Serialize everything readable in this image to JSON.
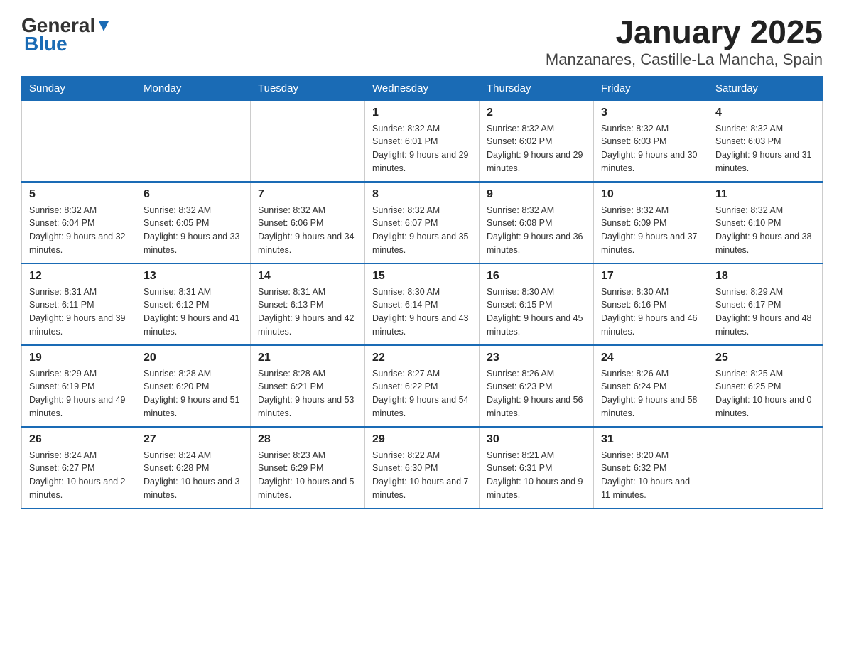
{
  "header": {
    "logo_general": "General",
    "logo_blue": "Blue",
    "title": "January 2025",
    "subtitle": "Manzanares, Castille-La Mancha, Spain"
  },
  "days_of_week": [
    "Sunday",
    "Monday",
    "Tuesday",
    "Wednesday",
    "Thursday",
    "Friday",
    "Saturday"
  ],
  "weeks": [
    [
      {
        "day": "",
        "info": ""
      },
      {
        "day": "",
        "info": ""
      },
      {
        "day": "",
        "info": ""
      },
      {
        "day": "1",
        "info": "Sunrise: 8:32 AM\nSunset: 6:01 PM\nDaylight: 9 hours and 29 minutes."
      },
      {
        "day": "2",
        "info": "Sunrise: 8:32 AM\nSunset: 6:02 PM\nDaylight: 9 hours and 29 minutes."
      },
      {
        "day": "3",
        "info": "Sunrise: 8:32 AM\nSunset: 6:03 PM\nDaylight: 9 hours and 30 minutes."
      },
      {
        "day": "4",
        "info": "Sunrise: 8:32 AM\nSunset: 6:03 PM\nDaylight: 9 hours and 31 minutes."
      }
    ],
    [
      {
        "day": "5",
        "info": "Sunrise: 8:32 AM\nSunset: 6:04 PM\nDaylight: 9 hours and 32 minutes."
      },
      {
        "day": "6",
        "info": "Sunrise: 8:32 AM\nSunset: 6:05 PM\nDaylight: 9 hours and 33 minutes."
      },
      {
        "day": "7",
        "info": "Sunrise: 8:32 AM\nSunset: 6:06 PM\nDaylight: 9 hours and 34 minutes."
      },
      {
        "day": "8",
        "info": "Sunrise: 8:32 AM\nSunset: 6:07 PM\nDaylight: 9 hours and 35 minutes."
      },
      {
        "day": "9",
        "info": "Sunrise: 8:32 AM\nSunset: 6:08 PM\nDaylight: 9 hours and 36 minutes."
      },
      {
        "day": "10",
        "info": "Sunrise: 8:32 AM\nSunset: 6:09 PM\nDaylight: 9 hours and 37 minutes."
      },
      {
        "day": "11",
        "info": "Sunrise: 8:32 AM\nSunset: 6:10 PM\nDaylight: 9 hours and 38 minutes."
      }
    ],
    [
      {
        "day": "12",
        "info": "Sunrise: 8:31 AM\nSunset: 6:11 PM\nDaylight: 9 hours and 39 minutes."
      },
      {
        "day": "13",
        "info": "Sunrise: 8:31 AM\nSunset: 6:12 PM\nDaylight: 9 hours and 41 minutes."
      },
      {
        "day": "14",
        "info": "Sunrise: 8:31 AM\nSunset: 6:13 PM\nDaylight: 9 hours and 42 minutes."
      },
      {
        "day": "15",
        "info": "Sunrise: 8:30 AM\nSunset: 6:14 PM\nDaylight: 9 hours and 43 minutes."
      },
      {
        "day": "16",
        "info": "Sunrise: 8:30 AM\nSunset: 6:15 PM\nDaylight: 9 hours and 45 minutes."
      },
      {
        "day": "17",
        "info": "Sunrise: 8:30 AM\nSunset: 6:16 PM\nDaylight: 9 hours and 46 minutes."
      },
      {
        "day": "18",
        "info": "Sunrise: 8:29 AM\nSunset: 6:17 PM\nDaylight: 9 hours and 48 minutes."
      }
    ],
    [
      {
        "day": "19",
        "info": "Sunrise: 8:29 AM\nSunset: 6:19 PM\nDaylight: 9 hours and 49 minutes."
      },
      {
        "day": "20",
        "info": "Sunrise: 8:28 AM\nSunset: 6:20 PM\nDaylight: 9 hours and 51 minutes."
      },
      {
        "day": "21",
        "info": "Sunrise: 8:28 AM\nSunset: 6:21 PM\nDaylight: 9 hours and 53 minutes."
      },
      {
        "day": "22",
        "info": "Sunrise: 8:27 AM\nSunset: 6:22 PM\nDaylight: 9 hours and 54 minutes."
      },
      {
        "day": "23",
        "info": "Sunrise: 8:26 AM\nSunset: 6:23 PM\nDaylight: 9 hours and 56 minutes."
      },
      {
        "day": "24",
        "info": "Sunrise: 8:26 AM\nSunset: 6:24 PM\nDaylight: 9 hours and 58 minutes."
      },
      {
        "day": "25",
        "info": "Sunrise: 8:25 AM\nSunset: 6:25 PM\nDaylight: 10 hours and 0 minutes."
      }
    ],
    [
      {
        "day": "26",
        "info": "Sunrise: 8:24 AM\nSunset: 6:27 PM\nDaylight: 10 hours and 2 minutes."
      },
      {
        "day": "27",
        "info": "Sunrise: 8:24 AM\nSunset: 6:28 PM\nDaylight: 10 hours and 3 minutes."
      },
      {
        "day": "28",
        "info": "Sunrise: 8:23 AM\nSunset: 6:29 PM\nDaylight: 10 hours and 5 minutes."
      },
      {
        "day": "29",
        "info": "Sunrise: 8:22 AM\nSunset: 6:30 PM\nDaylight: 10 hours and 7 minutes."
      },
      {
        "day": "30",
        "info": "Sunrise: 8:21 AM\nSunset: 6:31 PM\nDaylight: 10 hours and 9 minutes."
      },
      {
        "day": "31",
        "info": "Sunrise: 8:20 AM\nSunset: 6:32 PM\nDaylight: 10 hours and 11 minutes."
      },
      {
        "day": "",
        "info": ""
      }
    ]
  ]
}
